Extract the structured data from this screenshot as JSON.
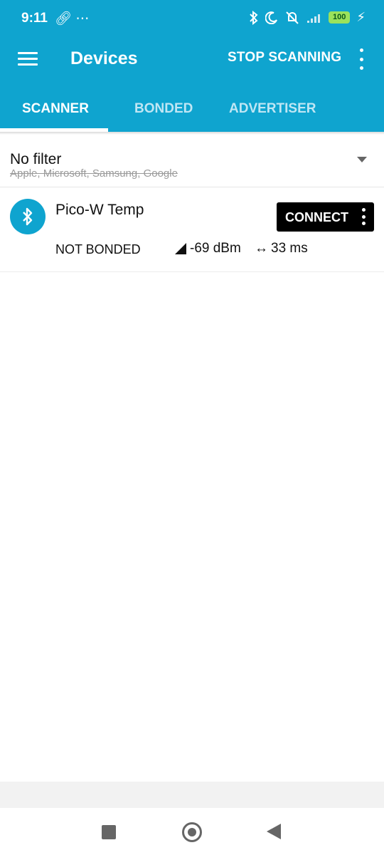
{
  "status_bar": {
    "time": "9:11",
    "left_icons": [
      "link-icon",
      "more-dots-icon"
    ],
    "right_icons": [
      "bluetooth-icon",
      "moon-icon",
      "muted-vibrate-icon",
      "signal-icon"
    ],
    "battery_level": "100"
  },
  "toolbar": {
    "title": "Devices",
    "stop_label": "STOP SCANNING"
  },
  "tabs": [
    {
      "label": "SCANNER",
      "active": true
    },
    {
      "label": "BONDED",
      "active": false
    },
    {
      "label": "ADVERTISER",
      "active": false
    }
  ],
  "filter": {
    "title": "No filter",
    "subtitle": "Apple, Microsoft, Samsung, Google"
  },
  "devices": [
    {
      "name": "Pico-W Temp",
      "connect_label": "CONNECT",
      "bond_state": "NOT BONDED",
      "rssi": "-69 dBm",
      "interval": "33 ms"
    }
  ],
  "colors": {
    "primary": "#0fa4cf",
    "connect_bg": "#000000",
    "battery": "#9be25b"
  }
}
